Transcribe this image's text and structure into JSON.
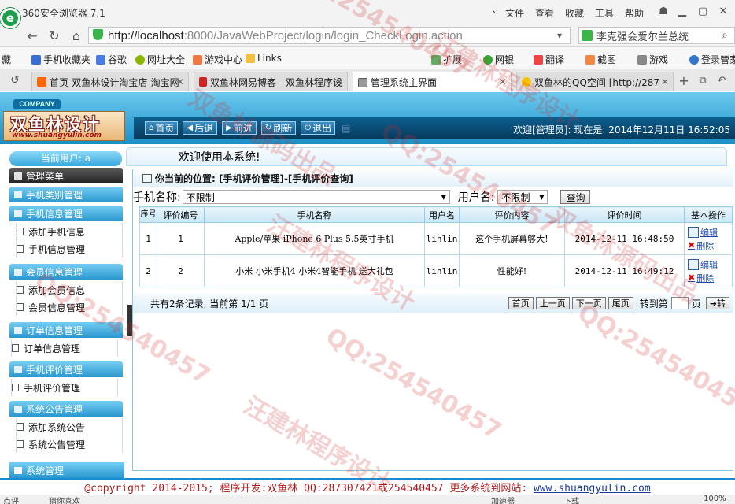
{
  "browser": {
    "title": "360安全浏览器 7.1",
    "menus": [
      "文件",
      "查看",
      "收藏",
      "工具",
      "帮助"
    ],
    "url_host": "http://localhost",
    "url_rest": ":8000/JavaWebProject/login/login_CheckLogin.action",
    "search_text": "李克强会爱尔兰总统",
    "bookmarks": [
      "藏",
      "手机收藏夹",
      "谷歌",
      "网址大全",
      "游戏中心",
      "Links"
    ],
    "tools": [
      "扩展",
      "网银",
      "翻译",
      "截图",
      "游戏",
      "登录管家"
    ],
    "tabs": [
      {
        "label": "首页-双鱼林设计淘宝店-淘宝网",
        "active": false
      },
      {
        "label": "双鱼林网易博客 - 双鱼林程序设",
        "active": false
      },
      {
        "label": "管理系统主界面",
        "active": true
      },
      {
        "label": "双鱼林的QQ空间 [http://287",
        "active": false
      }
    ]
  },
  "header": {
    "company": "COMPANY",
    "logo_text": "双鱼林设计",
    "logo_url": "www.shuangyulin.com",
    "nav": [
      "首页",
      "后退",
      "前进",
      "刷新",
      "退出"
    ],
    "welcome": "欢迎[管理员]: 现在是: 2014年12月11日 16:52:05"
  },
  "sidebar": {
    "current_user": "当前用户: a",
    "welcome_msg": "欢迎使用本系统!",
    "manage_menu": "管理菜单",
    "groups": [
      {
        "title": "手机类别管理",
        "items": []
      },
      {
        "title": "手机信息管理",
        "items": [
          "添加手机信息",
          "手机信息管理"
        ]
      },
      {
        "title": "会员信息管理",
        "items": [
          "添加会员信息",
          "会员信息管理"
        ]
      },
      {
        "title": "订单信息管理",
        "items": [
          "订单信息管理"
        ]
      },
      {
        "title": "手机评价管理",
        "items": [
          "手机评价管理"
        ]
      },
      {
        "title": "系统公告管理",
        "items": [
          "添加系统公告",
          "系统公告管理"
        ]
      }
    ],
    "system_manage": "系统管理"
  },
  "main": {
    "location": "你当前的位置: [手机评价管理]-[手机评价查询]",
    "filter": {
      "phone_label": "手机名称:",
      "phone_value": "不限制",
      "user_label": "用户名:",
      "user_value": "不限制",
      "query_button": "查询"
    },
    "columns": [
      "序号",
      "评价编号",
      "手机名称",
      "用户名",
      "评价内容",
      "评价时间",
      "基本操作"
    ],
    "rows": [
      {
        "no": "1",
        "id": "1",
        "phone": "Apple/苹果 iPhone 6 Plus 5.5英寸手机",
        "user": "linlin",
        "content": "这个手机屏幕够大!",
        "time": "2014-12-11 16:48:50"
      },
      {
        "no": "2",
        "id": "2",
        "phone": "小米 小米手机4 小米4智能手机 送大礼包",
        "user": "linlin",
        "content": "性能好!",
        "time": "2014-12-11 16:49:12"
      }
    ],
    "edit_label": "编辑",
    "delete_label": "删除",
    "pager": {
      "summary": "共有2条记录, 当前第 1/1 页",
      "first": "首页",
      "prev": "上一页",
      "next": "下一页",
      "last": "尾页",
      "goto": "转到第",
      "page_unit": "页",
      "go": "转"
    }
  },
  "footer": {
    "copyright": "@copyright 2014-2015; 程序开发:双鱼林  QQ:287307421或254540457  更多系统到网站: ",
    "site": "www.shuangyulin.com"
  },
  "status": {
    "left": "点评",
    "mid": "猜你喜欢",
    "accel": "加速器",
    "download": "下载",
    "zoom": "100%"
  },
  "watermarks": [
    "QQ:254540457",
    "汪建林程序设计",
    "双鱼林源码出品"
  ]
}
